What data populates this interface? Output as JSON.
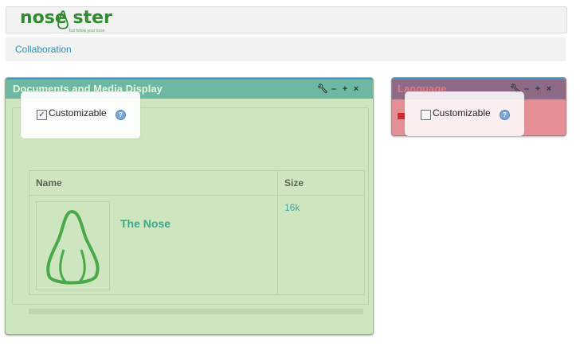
{
  "header": {
    "logo_text": "nose ster",
    "logo_tagline": "but follow your nose."
  },
  "nav": {
    "link": "Collaboration"
  },
  "docs_portlet": {
    "title": "Documents and Media Display",
    "tools": [
      "wrench-icon",
      "minimize-icon",
      "maximize-icon",
      "close-icon"
    ],
    "customizable": {
      "label": "Customizable",
      "checked": true,
      "icon": "help-icon"
    },
    "table": {
      "columns": [
        "Name",
        "Size"
      ],
      "rows": [
        {
          "name": "The Nose",
          "size": "16k",
          "thumbnail": "pear-nose-icon"
        }
      ]
    }
  },
  "lang_portlet": {
    "title": "Language",
    "flag": "flag-icon",
    "customizable": {
      "label": "Customizable",
      "checked": false,
      "icon": "help-icon"
    }
  },
  "colors": {
    "docs_body": "#cde6bf",
    "docs_titlebar": "#6eb8a3",
    "lang_body": "#e48f95",
    "lang_titlebar": "#8e6a86",
    "link": "#2b8fb7",
    "accent_green": "#3aa88a"
  }
}
